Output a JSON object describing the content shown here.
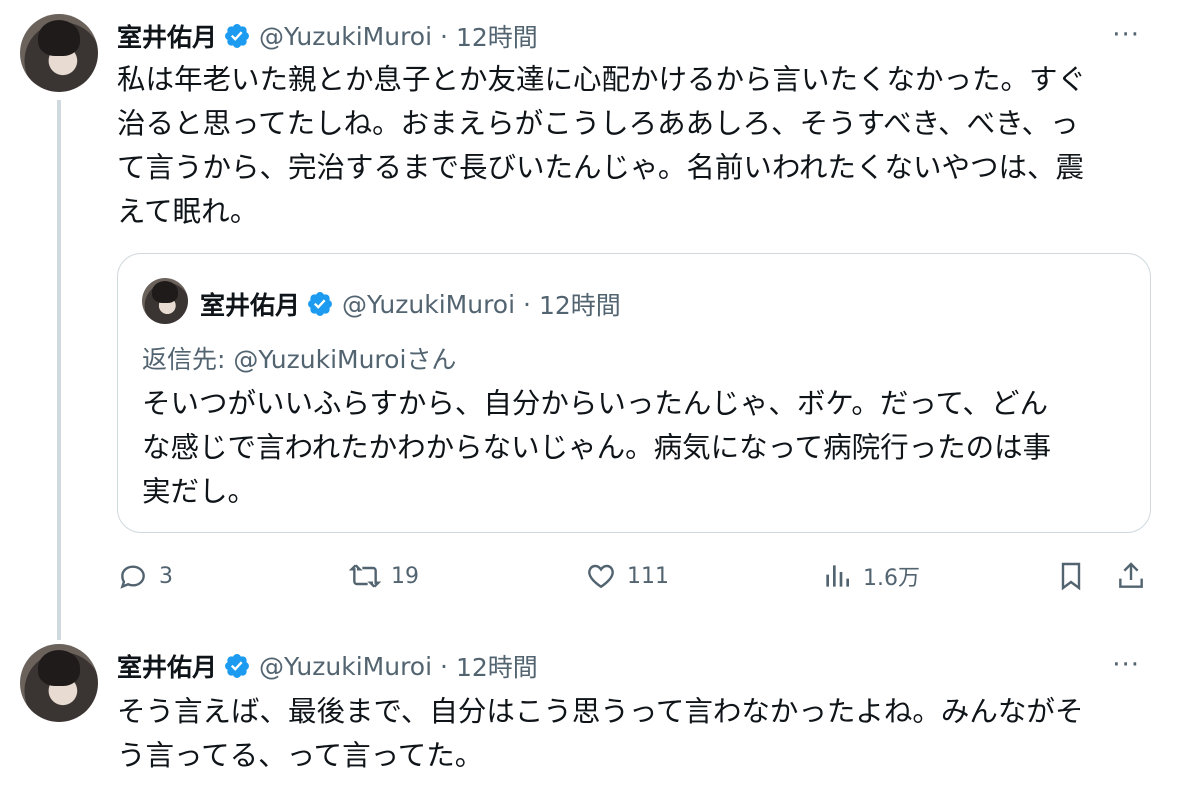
{
  "tweet1": {
    "name": "室井佑月",
    "handle": "@YuzukiMuroi",
    "time": "12時間",
    "more": "···",
    "lines": [
      "私は年老いた親とか息子とか友達に心配かけるから言いたくなかった。すぐ",
      "治ると思ってたしね。おまえらがこうしろああしろ、そうすべき、べき、っ",
      "て言うから、完治するまで長びいたんじゃ。名前いわれたくないやつは、震",
      "えて眠れ。"
    ],
    "quote": {
      "name": "室井佑月",
      "handle": "@YuzukiMuroi",
      "time": "12時間",
      "reply_label": "返信先: ",
      "reply_handle": "@YuzukiMuroiさん",
      "lines": [
        "そいつがいいふらすから、自分からいったんじゃ、ボケ。だって、どん",
        "な感じで言われたかわからないじゃん。病気になって病院行ったのは事",
        "実だし。"
      ]
    },
    "actions": {
      "replies": "3",
      "retweets": "19",
      "likes": "111",
      "views": "1.6万"
    }
  },
  "tweet2": {
    "name": "室井佑月",
    "handle": "@YuzukiMuroi",
    "time": "12時間",
    "more": "···",
    "lines": [
      "そう言えば、最後まで、自分はこう思うって言わなかったよね。みんながそ",
      "う言ってる、って言ってた。"
    ]
  },
  "colors": {
    "verified": "#1d9bf0",
    "muted": "#536471",
    "border": "#cfd9de"
  }
}
